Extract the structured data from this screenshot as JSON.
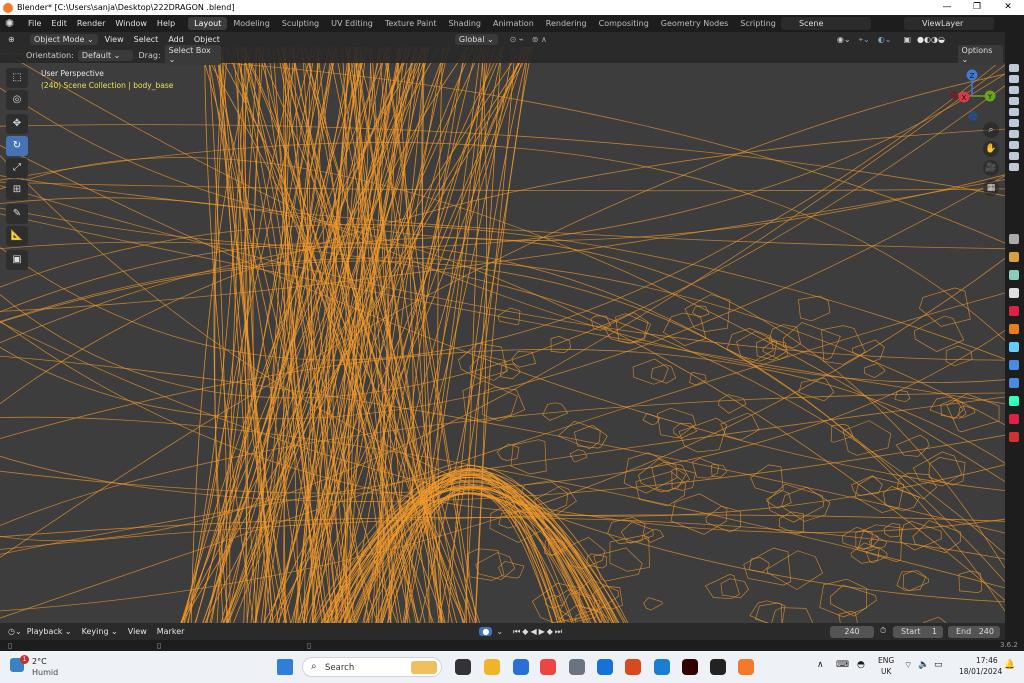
{
  "window": {
    "title": "Blender* [C:\\Users\\sanja\\Desktop\\222DRAGON .blend]",
    "minimize": "—",
    "maximize": "❐",
    "close": "✕"
  },
  "menu": [
    "File",
    "Edit",
    "Render",
    "Window",
    "Help"
  ],
  "workspaces": [
    "Layout",
    "Modeling",
    "Sculpting",
    "UV Editing",
    "Texture Paint",
    "Shading",
    "Animation",
    "Rendering",
    "Compositing",
    "Geometry Nodes",
    "Scripting"
  ],
  "workspace_add": "+",
  "scene": "Scene",
  "view_layer": "ViewLayer",
  "header": {
    "mode": "Object Mode",
    "menus": [
      "View",
      "Select",
      "Add",
      "Object"
    ],
    "transform_orientation": "Global"
  },
  "tool_settings": {
    "orientation_label": "Orientation:",
    "orientation_value": "Default",
    "drag_label": "Drag:",
    "drag_value": "Select Box",
    "options": "Options"
  },
  "viewport": {
    "perspective": "User Perspective",
    "collection_info": "(240) Scene Collection | body_base",
    "wire_color": "#f39a2c"
  },
  "gizmo": {
    "x": "X",
    "y": "Y",
    "z": "Z"
  },
  "timeline": {
    "menus": [
      "Playback",
      "Keying",
      "View",
      "Marker"
    ],
    "current_frame": "240",
    "start_label": "Start",
    "start": "1",
    "end_label": "End",
    "end": "240"
  },
  "status": {
    "version": "3.6.2"
  },
  "taskbar": {
    "weather_temp": "2°C",
    "weather_desc": "Humid",
    "weather_badge": "1",
    "search": "Search",
    "lang1": "ENG",
    "lang2": "UK",
    "time": "17:46",
    "date": "18/01/2024"
  },
  "colors": {
    "accent": "#4772b3",
    "wire": "#f39a2c",
    "viewport_bg": "#3d3d3d",
    "active_text": "#e8e05a"
  }
}
